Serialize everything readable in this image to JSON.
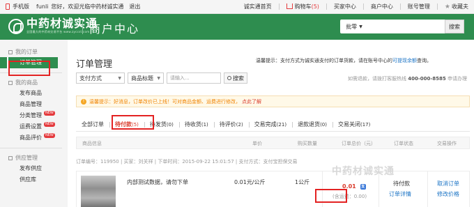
{
  "topbar": {
    "mobile": "手机版",
    "user": "funli",
    "welcome": "您好，欢迎光临中药材诚实通",
    "logout": "退出",
    "links": [
      "诚实通首页",
      "购物车",
      "买家中心",
      "商户中心",
      "账号管理",
      "收藏夫"
    ],
    "cart_count": "(5)"
  },
  "header": {
    "logo_cn": "中药材诚实通",
    "logo_sub": "全国最大的中药材交易平台 www.zyccst.com",
    "section_title": "商户中心",
    "search_category": "批零",
    "search_button": "搜索"
  },
  "sidebar": {
    "groups": [
      {
        "title": "我的订单",
        "items": [
          {
            "label": "订单管理"
          }
        ]
      },
      {
        "title": "我的商品",
        "items": [
          {
            "label": "发布商品"
          },
          {
            "label": "商品管理"
          },
          {
            "label": "分类管理",
            "badge": "NEW"
          },
          {
            "label": "运费设置",
            "badge": "NEW"
          },
          {
            "label": "商品评价",
            "badge": "NEW"
          }
        ]
      },
      {
        "title": "供应管理",
        "items": [
          {
            "label": "发布供应"
          },
          {
            "label": "供应库"
          }
        ]
      }
    ]
  },
  "main": {
    "title": "订单管理",
    "tip_prefix": "温馨提示：支付方式为诚实通支付的订单货款，请在账号中心的",
    "tip_link": "可提现余额",
    "tip_suffix": "查询。",
    "filters": {
      "pay_method": "支付方式",
      "product_title": "商品标题",
      "keyword_placeholder": "请输入...",
      "search": "搜索"
    },
    "refund": {
      "prefix": "如需退款，请拨打客服热线",
      "phone": "400-000-8585",
      "apply": "申请办理"
    },
    "notice": {
      "text": "温馨提示：好消息，订单改价已上线！可对商品金额、运费进行修改，",
      "link": "点此了解"
    },
    "tabs": [
      {
        "label": "全部订单",
        "count": ""
      },
      {
        "label": "待付款",
        "count": "(5)"
      },
      {
        "label": "待发货",
        "count": "(0)"
      },
      {
        "label": "待收货",
        "count": "(1)"
      },
      {
        "label": "待评价",
        "count": "(2)"
      },
      {
        "label": "交易完成",
        "count": "(21)"
      },
      {
        "label": "退款退货",
        "count": "(0)"
      },
      {
        "label": "交易关闭",
        "count": "(17)"
      }
    ],
    "columns": [
      "商品信息",
      "单价",
      "购买数量",
      "订单总价（元）",
      "订单状态",
      "交易操作"
    ],
    "order": {
      "meta": "订单编号：119950 | 买家：刘关祥 | 下单时间：2015-09-22 15:01:57 | 支付方式：支付宝担保交易",
      "product_name": "内部测试数据，请勿下单",
      "price": "0.01元/公斤",
      "qty": "1公斤",
      "total": "0.01",
      "freight": "(含运费：0.00)",
      "status": "待付款",
      "detail_link": "订单详情",
      "actions": [
        "取消订单",
        "修改价格"
      ]
    }
  },
  "watermark": "中药材诚实通"
}
